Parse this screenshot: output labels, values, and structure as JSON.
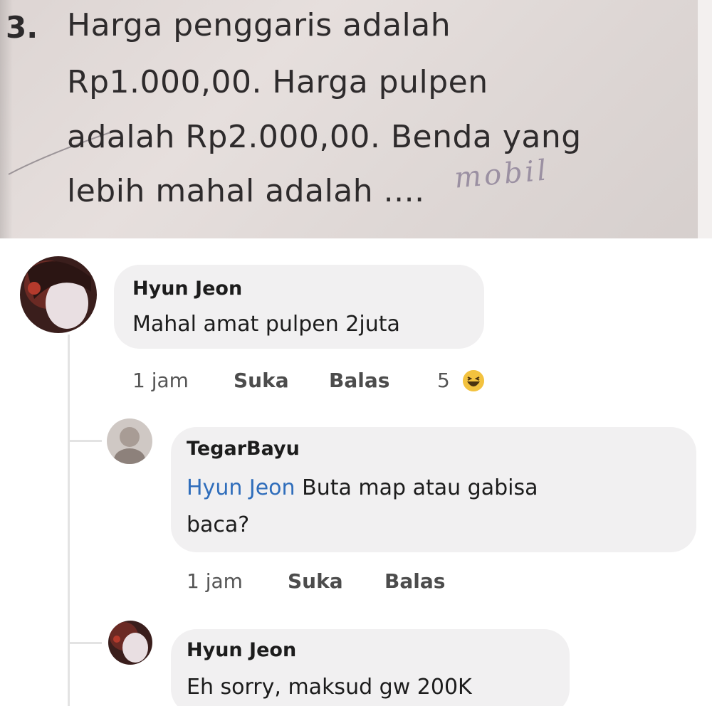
{
  "worksheet": {
    "number": "3.",
    "lines": [
      "Harga penggaris adalah",
      "Rp1.000,00. Harga pulpen",
      "adalah Rp2.000,00. Benda yang",
      "lebih mahal adalah ...."
    ],
    "handwritten_answer": "mobil"
  },
  "comments": [
    {
      "author": "Hyun Jeon",
      "text": "Mahal amat pulpen 2juta",
      "time": "1 jam",
      "like_label": "Suka",
      "reply_label": "Balas",
      "reaction_count": "5",
      "reaction_icon": "haha-emoji-icon"
    },
    {
      "author": "TegarBayu",
      "mention": "Hyun Jeon",
      "text_line1": "Buta map atau gabisa",
      "text_line2": "baca?",
      "time": "1 jam",
      "like_label": "Suka",
      "reply_label": "Balas"
    },
    {
      "author": "Hyun Jeon",
      "text": "Eh sorry, maksud gw 200K"
    }
  ],
  "colors": {
    "mention": "#2f6dbb",
    "bubble": "#f1f0f1",
    "reaction": "#f3c23f"
  }
}
